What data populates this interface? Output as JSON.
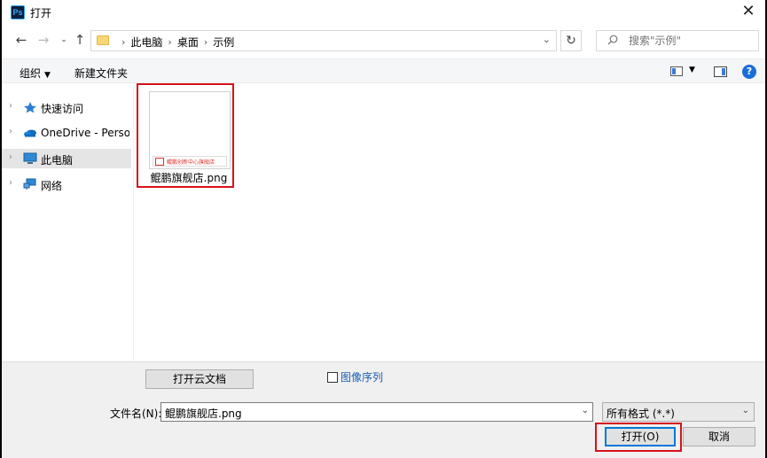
{
  "window": {
    "title": "打开",
    "app_icon_text": "Ps"
  },
  "addressbar": {
    "crumbs": [
      "此电脑",
      "桌面",
      "示例"
    ]
  },
  "search": {
    "placeholder": "搜索\"示例\""
  },
  "toolbar": {
    "organize_label": "组织",
    "new_folder_label": "新建文件夹"
  },
  "sidebar": {
    "items": [
      {
        "label": "快速访问",
        "icon": "star-icon"
      },
      {
        "label": "OneDrive - Personal",
        "icon": "cloud-icon"
      },
      {
        "label": "此电脑",
        "icon": "computer-icon",
        "selected": true
      },
      {
        "label": "网络",
        "icon": "network-icon"
      }
    ]
  },
  "files": [
    {
      "name": "鲲鹏旗舰店.png",
      "thumb_text": "鲲鹏创新中心旗舰店"
    }
  ],
  "bottom": {
    "cloud_button_label": "打开云文档",
    "image_sequence_label": "图像序列",
    "filename_label": "文件名(N):",
    "filename_value": "鲲鹏旗舰店.png",
    "filetype_value": "所有格式 (*.*)",
    "open_label": "打开(O)",
    "cancel_label": "取消"
  },
  "colors": {
    "highlight_red": "#d6121b",
    "accent_blue": "#0078d7"
  }
}
